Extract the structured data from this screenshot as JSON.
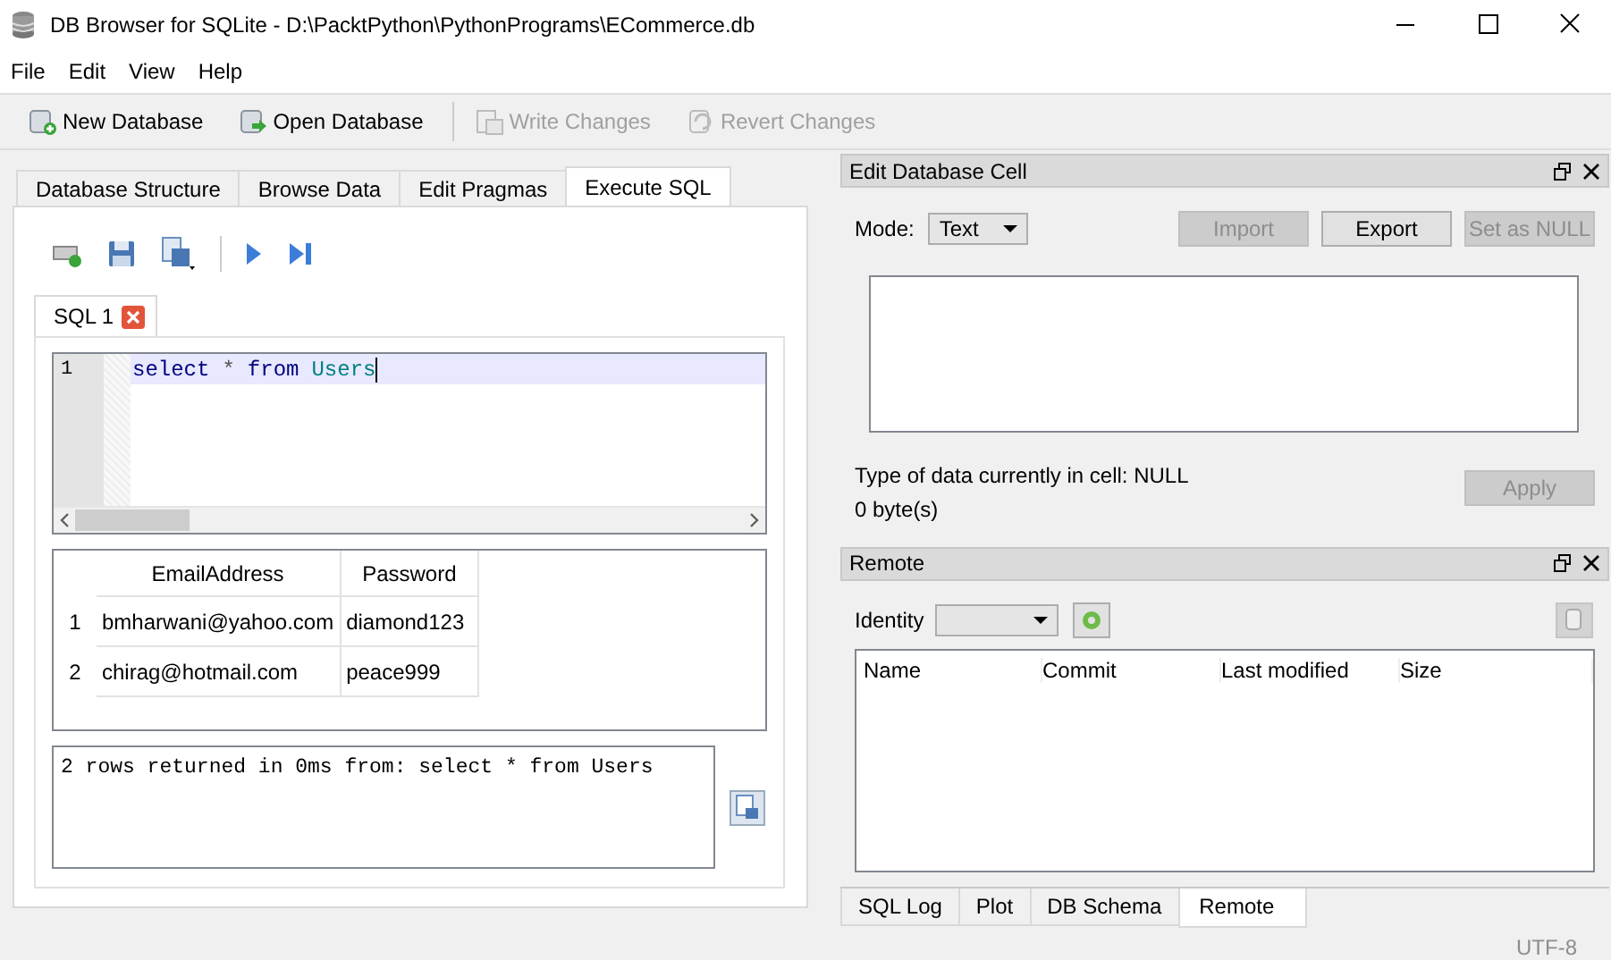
{
  "window": {
    "title": "DB Browser for SQLite - D:\\PacktPython\\PythonPrograms\\ECommerce.db"
  },
  "menu": [
    "File",
    "Edit",
    "View",
    "Help"
  ],
  "toolbar": [
    {
      "kind": "new",
      "label": "New Database",
      "disabled": false
    },
    {
      "kind": "open",
      "label": "Open Database",
      "disabled": false
    },
    {
      "kind": "write",
      "label": "Write Changes",
      "disabled": true
    },
    {
      "kind": "revert",
      "label": "Revert Changes",
      "disabled": true
    }
  ],
  "main_tabs": [
    {
      "label": "Database Structure",
      "selected": false
    },
    {
      "label": "Browse Data",
      "selected": false
    },
    {
      "label": "Edit Pragmas",
      "selected": false
    },
    {
      "label": "Execute SQL",
      "selected": true
    }
  ],
  "sql_tabs": [
    {
      "label": "SQL 1",
      "selected": true
    }
  ],
  "editor": {
    "line_numbers": [
      "1"
    ],
    "query": [
      {
        "kind": "keyword",
        "text": "select"
      },
      {
        "kind": "operator",
        "text": "*"
      },
      {
        "kind": "keyword",
        "text": "from"
      },
      {
        "kind": "identifier",
        "text": "Users"
      }
    ]
  },
  "results": {
    "columns": [
      "EmailAddress",
      "Password"
    ],
    "rows": [
      {
        "number": "1",
        "cells": [
          "bmharwani@yahoo.com",
          "diamond123"
        ]
      },
      {
        "number": "2",
        "cells": [
          "chirag@hotmail.com",
          "peace999"
        ]
      }
    ]
  },
  "message": "2 rows returned in 0ms from: select * from Users",
  "edit_cell": {
    "title": "Edit Database Cell",
    "mode_label": "Mode:",
    "mode": "Text",
    "buttons": [
      {
        "label": "Import",
        "disabled": true
      },
      {
        "label": "Export",
        "disabled": false
      },
      {
        "label": "Set as NULL",
        "disabled": true
      }
    ],
    "type_info": "Type of data currently in cell: NULL",
    "size": "0 byte(s)",
    "apply": {
      "label": "Apply",
      "disabled": true
    }
  },
  "remote": {
    "title": "Remote",
    "identity_label": "Identity",
    "columns": [
      "Name",
      "Commit",
      "Last modified",
      "Size"
    ]
  },
  "dock_tabs": [
    {
      "label": "SQL Log",
      "selected": false
    },
    {
      "label": "Plot",
      "selected": false
    },
    {
      "label": "DB Schema",
      "selected": false
    },
    {
      "label": "Remote",
      "selected": true
    }
  ],
  "status_bar": {
    "encoding": "UTF-8"
  }
}
